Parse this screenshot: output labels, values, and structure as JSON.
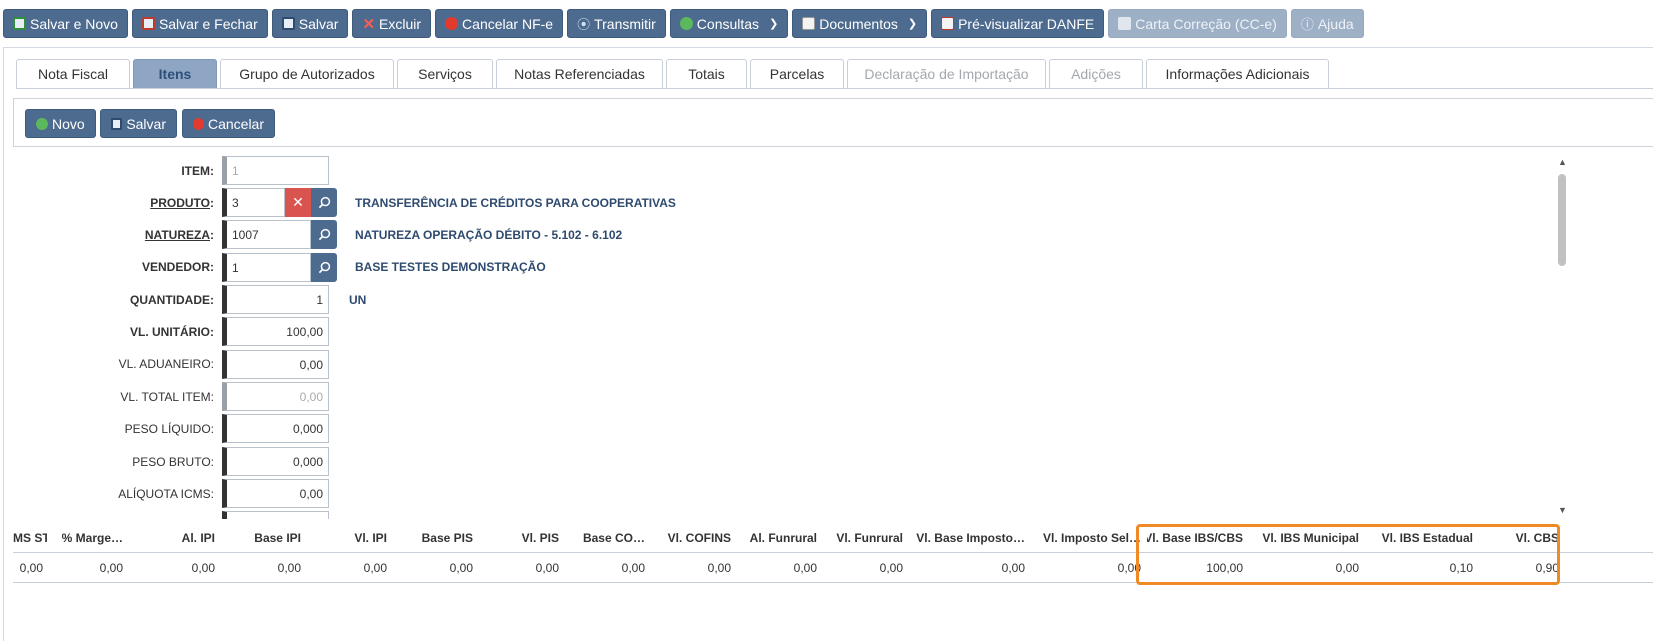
{
  "toolbar": {
    "buttons": [
      {
        "label": "Salvar e Novo",
        "icon": "save-new-icon"
      },
      {
        "label": "Salvar e Fechar",
        "icon": "save-close-icon"
      },
      {
        "label": "Salvar",
        "icon": "save-icon"
      },
      {
        "label": "Excluir",
        "icon": "delete-icon"
      },
      {
        "label": "Cancelar NF-e",
        "icon": "cancel-icon"
      },
      {
        "label": "Transmitir",
        "icon": "transmit-icon"
      },
      {
        "label": "Consultas",
        "icon": "globe-icon"
      },
      {
        "label": "Documentos",
        "icon": "document-icon"
      },
      {
        "label": "Pré-visualizar DANFE",
        "icon": "preview-icon"
      },
      {
        "label": "Carta Correção (CC-e)",
        "icon": "letter-icon"
      },
      {
        "label": "Ajuda",
        "icon": "help-icon"
      }
    ]
  },
  "tabs": [
    {
      "label": "Nota Fiscal",
      "state": "normal"
    },
    {
      "label": "Itens",
      "state": "active"
    },
    {
      "label": "Grupo de Autorizados",
      "state": "normal"
    },
    {
      "label": "Serviços",
      "state": "normal"
    },
    {
      "label": "Notas Referenciadas",
      "state": "normal"
    },
    {
      "label": "Totais",
      "state": "normal"
    },
    {
      "label": "Parcelas",
      "state": "normal"
    },
    {
      "label": "Declaração de Importação",
      "state": "disabled"
    },
    {
      "label": "Adições",
      "state": "disabled"
    },
    {
      "label": "Informações Adicionais",
      "state": "normal"
    }
  ],
  "subtoolbar": {
    "novo": "Novo",
    "salvar": "Salvar",
    "cancelar": "Cancelar"
  },
  "form": {
    "item": {
      "label": "ITEM:",
      "value": "1"
    },
    "produto": {
      "label": "PRODUTO",
      "colon": ":",
      "value": "3",
      "desc": "TRANSFERÊNCIA DE CRÉDITOS PARA COOPERATIVAS"
    },
    "natureza": {
      "label": "NATUREZA",
      "colon": ":",
      "value": "1007",
      "desc": "NATUREZA OPERAÇÃO DÉBITO - 5.102 - 6.102"
    },
    "vendedor": {
      "label": "VENDEDOR:",
      "value": "1",
      "desc": "BASE TESTES DEMONSTRAÇÃO"
    },
    "quantidade": {
      "label": "QUANTIDADE:",
      "value": "1",
      "unit": "UN"
    },
    "vl_unitario": {
      "label": "VL. UNITÁRIO:",
      "value": "100,00"
    },
    "vl_aduaneiro": {
      "label": "VL. ADUANEIRO:",
      "value": "0,00"
    },
    "vl_total_item": {
      "label": "VL. TOTAL ITEM:",
      "value": "0,00"
    },
    "peso_liquido": {
      "label": "PESO LÍQUIDO:",
      "value": "0,000"
    },
    "peso_bruto": {
      "label": "PESO BRUTO:",
      "value": "0,000"
    },
    "aliquota_icms": {
      "label": "ALÍQUOTA ICMS:",
      "value": "0,00"
    }
  },
  "grid": {
    "headers": [
      "MS ST.",
      "% Marge…",
      "Al. IPI",
      "Base IPI",
      "Vl. IPI",
      "Base PIS",
      "Vl. PIS",
      "Base CO…",
      "Vl. COFINS",
      "Al. Funrural",
      "Vl. Funrural",
      "Vl. Base Imposto…",
      "Vl. Imposto Sel…",
      "Vl. Base IBS/CBS",
      "Vl. IBS Municipal",
      "Vl. IBS Estadual",
      "Vl. CBS"
    ],
    "row": [
      "0,00",
      "0,00",
      "0,00",
      "0,00",
      "0,00",
      "0,00",
      "0,00",
      "0,00",
      "0,00",
      "0,00",
      "0,00",
      "0,00",
      "0,00",
      "100,00",
      "0,00",
      "0,10",
      "0,90"
    ]
  },
  "colors": {
    "button": "#4d6a8f",
    "tab_active": "#8ea6c4",
    "highlight": "#f08a24",
    "clear": "#d9534f"
  }
}
